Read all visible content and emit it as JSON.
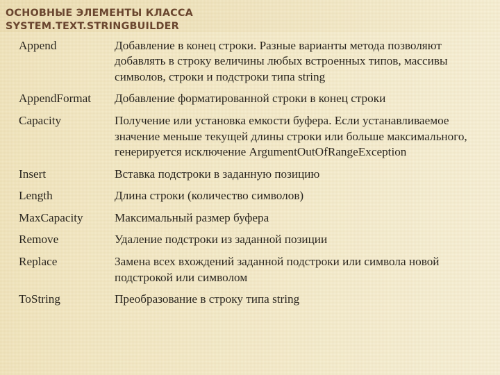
{
  "slide": {
    "title_lines": [
      "Основные элементы класса",
      "System.Text.StringBuilder"
    ],
    "title_color": "#5e3822",
    "background_color": "#f3e8c6",
    "text_color": "#171410"
  },
  "table": {
    "rows": [
      {
        "name": "Append",
        "description": "Добавление в конец строки. Разные варианты метода позволяют добавлять в строку величины любых встроенных типов, массивы символов, строки и подстроки типа string"
      },
      {
        "name": "AppendFormat",
        "description": "Добавление форматированной строки в конец строки"
      },
      {
        "name": "Capacity",
        "description": "Получение или установка емкости буфера. Если устанавливаемое значение меньше текущей длины строки или больше максимального, генерируется исключение ArgumentOutOfRangeException"
      },
      {
        "name": "Insert",
        "description": "Вставка подстроки в заданную позицию"
      },
      {
        "name": "Length",
        "description": "Длина строки (количество символов)"
      },
      {
        "name": "MaxCapacity",
        "description": "Максимальный размер буфера"
      },
      {
        "name": "Remove",
        "description": "Удаление подстроки из заданной позиции"
      },
      {
        "name": "Replace",
        "description": "Замена всех вхождений заданной подстроки или символа новой подстрокой или символом"
      },
      {
        "name": "ToString",
        "description": "Преобразование в строку типа string"
      }
    ]
  }
}
